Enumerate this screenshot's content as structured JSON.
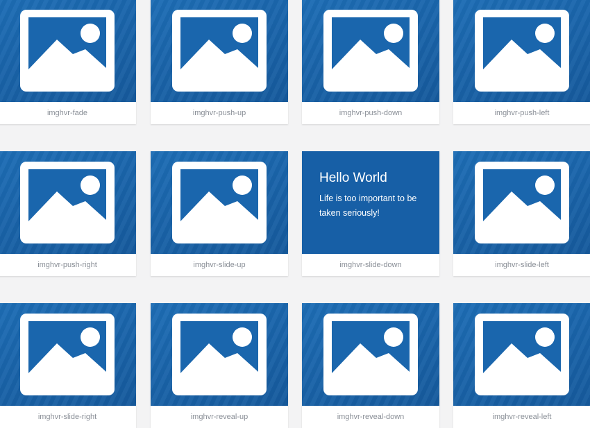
{
  "colors": {
    "tile_blue": "#1a66ad",
    "caption_text": "#8a8f97",
    "background": "#f3f3f4"
  },
  "icons": {
    "thumbnail": "image-placeholder-icon"
  },
  "cards": [
    {
      "caption": "imghvr-fade"
    },
    {
      "caption": "imghvr-push-up"
    },
    {
      "caption": "imghvr-push-down"
    },
    {
      "caption": "imghvr-push-left"
    },
    {
      "caption": "imghvr-push-right"
    },
    {
      "caption": "imghvr-slide-up"
    },
    {
      "caption": "imghvr-slide-down",
      "hover": {
        "title": "Hello World",
        "text": "Life is too important to be taken seriously!"
      }
    },
    {
      "caption": "imghvr-slide-left"
    },
    {
      "caption": "imghvr-slide-right"
    },
    {
      "caption": "imghvr-reveal-up"
    },
    {
      "caption": "imghvr-reveal-down"
    },
    {
      "caption": "imghvr-reveal-left"
    }
  ]
}
